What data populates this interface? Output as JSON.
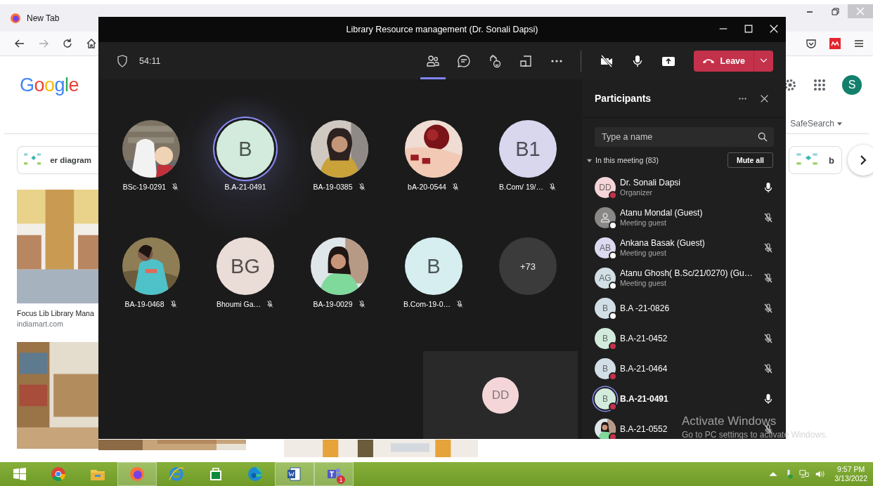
{
  "browser": {
    "tabs": [
      {
        "label": "New Tab",
        "selected": false
      }
    ],
    "logo": "Google",
    "account_initial": "S",
    "safesearch": "SafeSearch",
    "chips": [
      {
        "label": "er diagram"
      },
      {
        "label": "b"
      }
    ],
    "results": [
      {
        "title": "Focus Lib Library Mana",
        "source": "indiamart.com"
      }
    ]
  },
  "meeting": {
    "title": "Library Resource management (Dr. Sonali Dapsi)",
    "timer": "54:11",
    "toolbar": [
      {
        "kind": "people",
        "selected": true
      },
      {
        "kind": "chat",
        "selected": false
      },
      {
        "kind": "react",
        "selected": false
      },
      {
        "kind": "rooms",
        "selected": false
      },
      {
        "kind": "more",
        "selected": false
      }
    ],
    "controls": [
      {
        "kind": "camera-off"
      },
      {
        "kind": "mic"
      },
      {
        "kind": "share"
      }
    ],
    "leave": "Leave",
    "tiles": [
      {
        "kind": "picture",
        "name": "BSc-19-0291",
        "muted": true,
        "speaking": false
      },
      {
        "kind": "initials",
        "initials": "B",
        "color": "#d2ebdc",
        "name": "B.A-21-0491",
        "muted": false,
        "speaking": true
      },
      {
        "kind": "picture",
        "name": "BA-19-0385",
        "muted": true,
        "speaking": false
      },
      {
        "kind": "picture",
        "name": "bA-20-0544",
        "muted": true,
        "speaking": false
      },
      {
        "kind": "initials",
        "initials": "B1",
        "color": "#d9d7ee",
        "name": "B.Com/ 19/…",
        "muted": true,
        "speaking": false
      },
      {
        "kind": "picture",
        "name": "BA-19-0468",
        "muted": true,
        "speaking": false
      },
      {
        "kind": "initials",
        "initials": "BG",
        "color": "#eadcd7",
        "name": "Bhoumi Ga…",
        "muted": true,
        "speaking": false
      },
      {
        "kind": "picture",
        "name": "BA-19-0029",
        "muted": true,
        "speaking": false
      },
      {
        "kind": "initials",
        "initials": "B",
        "color": "#d7eef1",
        "name": "B.Com-19-0…",
        "muted": true,
        "speaking": false
      },
      {
        "kind": "overflow",
        "count": "+73"
      }
    ],
    "self_view": {
      "initials": "DD",
      "color": "#f4d6d8"
    }
  },
  "participants": {
    "title": "Participants",
    "search": {
      "placeholder": "Type a name"
    },
    "section": {
      "label": "In this meeting (83)",
      "expanded": true
    },
    "mute_all": "Mute all",
    "people": [
      {
        "name": "Dr. Sonali Dapsi",
        "role": "Organizer",
        "avatar": {
          "kind": "initials",
          "initials": "DD",
          "color": "#f5d5d8"
        },
        "status": {
          "color": "#c4314b"
        },
        "muted": false,
        "speaking": false
      },
      {
        "name": "Atanu Mondal (Guest)",
        "role": "Meeting guest",
        "avatar": {
          "kind": "guest",
          "color": "#8a8886"
        },
        "status": {
          "color": "#ffffff"
        },
        "muted": true,
        "speaking": false
      },
      {
        "name": "Ankana Basak (Guest)",
        "role": "Meeting guest",
        "avatar": {
          "kind": "initials",
          "initials": "AB",
          "color": "#dcdaf0"
        },
        "status": {
          "color": "#ffffff"
        },
        "muted": true,
        "speaking": false
      },
      {
        "name": "Atanu Ghosh( B.Sc/21/0270) (Gu…",
        "role": "Meeting guest",
        "avatar": {
          "kind": "initials",
          "initials": "AG",
          "color": "#d2e0e5"
        },
        "status": {
          "color": "#ffffff"
        },
        "muted": true,
        "speaking": false
      },
      {
        "name": "B.A -21-0826",
        "avatar": {
          "kind": "initials",
          "initials": "B",
          "color": "#d2dee6"
        },
        "status": {
          "color": "#ffffff"
        },
        "muted": true,
        "speaking": false
      },
      {
        "name": "B.A-21-0452",
        "avatar": {
          "kind": "initials",
          "initials": "B",
          "color": "#d3ebdc"
        },
        "status": {
          "color": "#c4314b"
        },
        "muted": true,
        "speaking": false
      },
      {
        "name": "B.A-21-0464",
        "avatar": {
          "kind": "initials",
          "initials": "B",
          "color": "#d2dee6"
        },
        "status": {
          "color": "#c4314b"
        },
        "muted": true,
        "speaking": false
      },
      {
        "name": "B.A-21-0491",
        "avatar": {
          "kind": "initials",
          "initials": "B",
          "color": "#d3ebdc"
        },
        "status": {
          "color": "#c4314b"
        },
        "muted": false,
        "speaking": true
      },
      {
        "name": "B.A-21-0552",
        "status": {
          "color": "#c4314b"
        },
        "muted": true,
        "speaking": false
      }
    ]
  },
  "activation": {
    "title": "Activate Windows",
    "detail": "Go to PC settings to activate Windows."
  },
  "taskbar": {
    "apps": [
      {
        "kind": "chrome",
        "selected": false
      },
      {
        "kind": "explorer",
        "selected": false
      },
      {
        "kind": "firefox",
        "selected": true
      },
      {
        "kind": "ie",
        "selected": false
      },
      {
        "kind": "store",
        "selected": false
      },
      {
        "kind": "edge",
        "selected": false
      },
      {
        "kind": "word",
        "selected": true
      },
      {
        "kind": "teams",
        "selected": true,
        "badge": "1"
      }
    ],
    "time": "9:57 PM",
    "date": "3/13/2022"
  }
}
